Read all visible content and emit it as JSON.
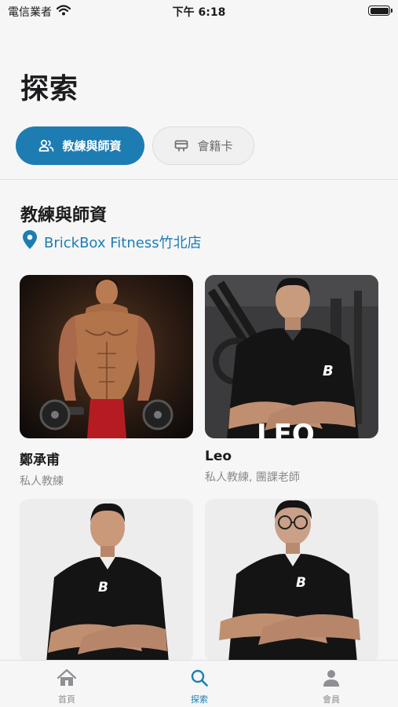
{
  "status_bar": {
    "carrier": "電信業者",
    "time": "下午 6:18"
  },
  "page_title": "探索",
  "tabs": [
    {
      "label": "教練與師資",
      "icon": "users-icon",
      "active": true
    },
    {
      "label": "會籍卡",
      "icon": "card-icon",
      "active": false
    }
  ],
  "section": {
    "title": "教練與師資",
    "location": "BrickBox Fitness竹北店"
  },
  "coaches": [
    {
      "name": "鄭承甫",
      "role": "私人教練"
    },
    {
      "name": "Leo",
      "role": "私人教練, 團課老師",
      "photo_text": "LEO"
    },
    {
      "name": "",
      "role": ""
    },
    {
      "name": "",
      "role": ""
    }
  ],
  "tabbar": [
    {
      "label": "首頁",
      "icon": "home-icon"
    },
    {
      "label": "探索",
      "icon": "search-icon",
      "active": true
    },
    {
      "label": "會員",
      "icon": "person-icon"
    }
  ],
  "colors": {
    "accent": "#1d7db3",
    "background": "#f6f6f7"
  }
}
